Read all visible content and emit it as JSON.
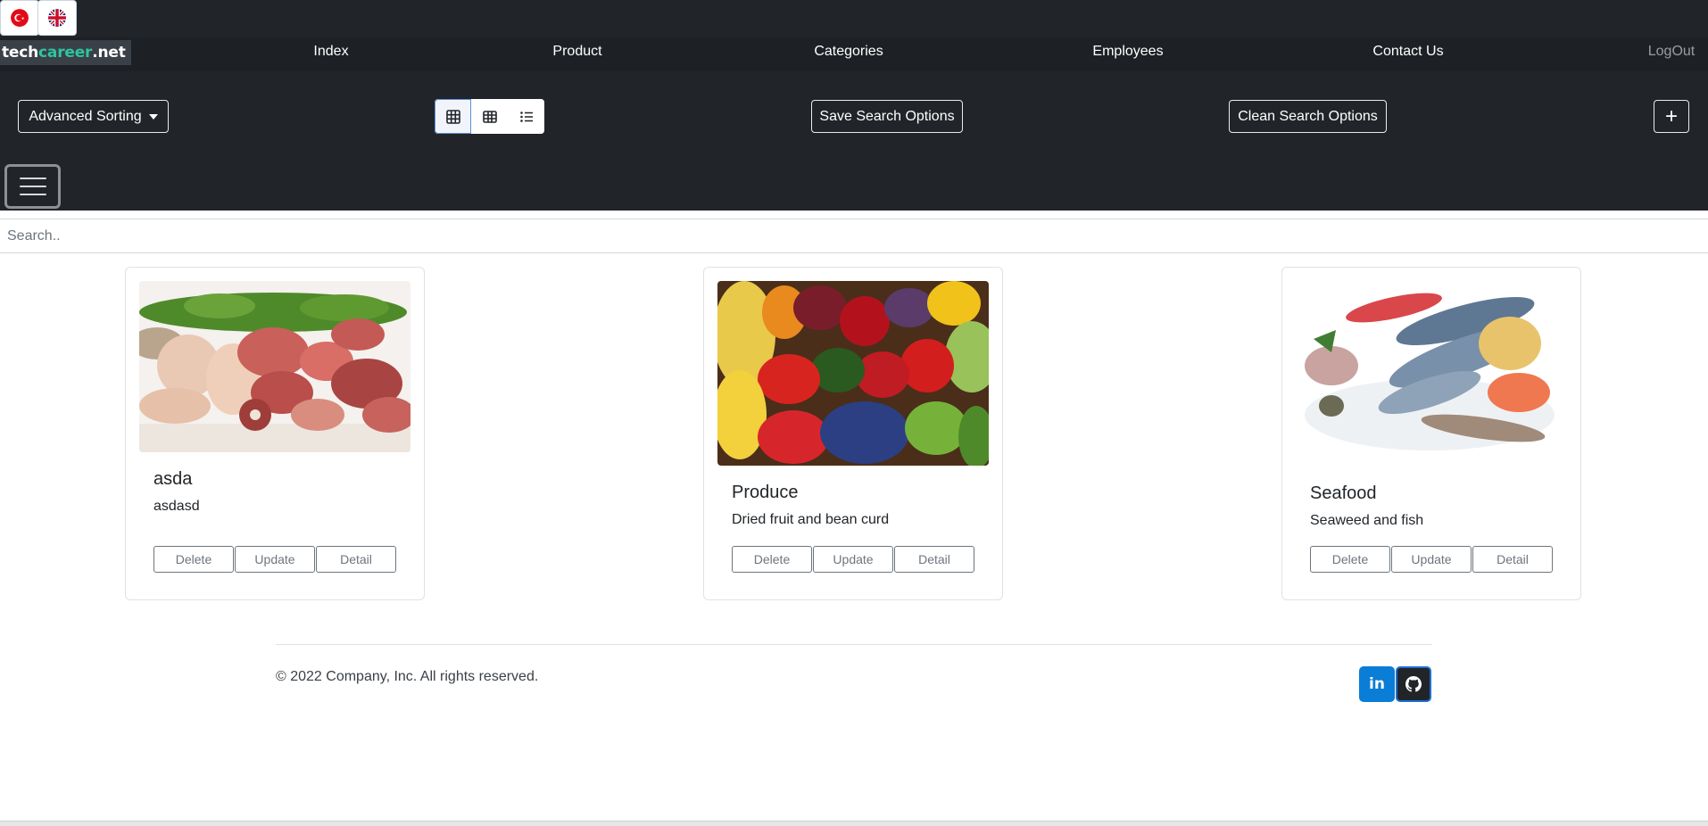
{
  "languages": [
    {
      "code": "tr",
      "icon": "turkey-flag-icon"
    },
    {
      "code": "en",
      "icon": "uk-flag-icon"
    }
  ],
  "brand": {
    "part1": "tech",
    "part2": "career",
    "part3": ".net",
    "accent": "#2ec4a0"
  },
  "nav": {
    "index": "Index",
    "product": "Product",
    "categories": "Categories",
    "employees": "Employees",
    "contact": "Contact Us",
    "logout": "LogOut"
  },
  "toolbar": {
    "sorting_label": "Advanced Sorting",
    "save_label": "Save Search Options",
    "clean_label": "Clean Search Options",
    "add_label": "+",
    "view_modes": [
      "grid-large-icon",
      "grid-small-icon",
      "list-icon"
    ],
    "active_view": 0
  },
  "search": {
    "placeholder": "Search..",
    "value": ""
  },
  "categories": [
    {
      "name": "asda",
      "description": "asdasd",
      "image": "meat-photo"
    },
    {
      "name": "Produce",
      "description": "Dried fruit and bean curd",
      "image": "produce-photo"
    },
    {
      "name": "Seafood",
      "description": "Seaweed and fish",
      "image": "seafood-photo"
    }
  ],
  "card_actions": {
    "delete": "Delete",
    "update": "Update",
    "detail": "Detail"
  },
  "footer": {
    "copyright": "© 2022 Company, Inc. All rights reserved.",
    "linkedin_glyph": "in",
    "social": [
      "linkedin-icon",
      "github-icon"
    ]
  },
  "colors": {
    "header_bg": "#212529",
    "linkedin": "#0a7dd6"
  }
}
